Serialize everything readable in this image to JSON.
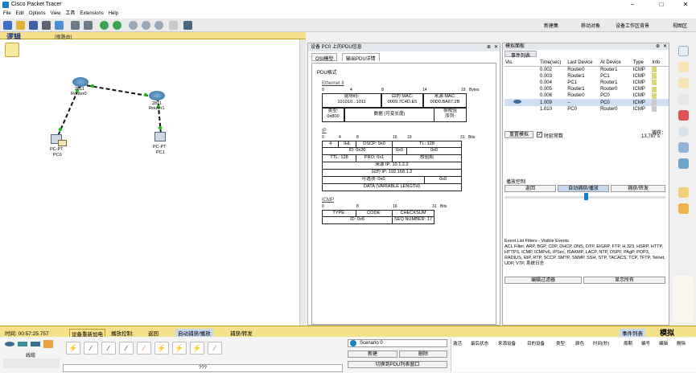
{
  "app": {
    "title": "Cisco Packet Tracer",
    "minimize": "–",
    "maximize": "□",
    "close": "✕"
  },
  "menu": [
    "File",
    "Edit",
    "Options",
    "View",
    "工具",
    "Extensions",
    "Help"
  ],
  "toolbar_right": [
    "新建集",
    "移动对象",
    "设备工作区背景",
    "视图区"
  ],
  "workspace": {
    "mode_label": "逻辑",
    "root_label": "[根路由]",
    "devices": [
      {
        "name": "Router0",
        "model": "2811",
        "type": "router"
      },
      {
        "name": "Router1",
        "model": "2811",
        "type": "router"
      },
      {
        "name": "PC0",
        "model": "PC-PT",
        "type": "pc"
      },
      {
        "name": "PC1",
        "model": "PC-PT",
        "type": "pc"
      }
    ]
  },
  "pdu": {
    "window_title": "设备 PC0 上的PDU信息",
    "tabs": [
      "OSI模型",
      "输出PDU详情"
    ],
    "heading": "PDU格式",
    "ethernet": {
      "title": "Ethernet II",
      "ruler": [
        "0",
        "4",
        "8",
        "14",
        "19",
        "Bytes"
      ],
      "preamble_label": "前导码:",
      "preamble": "101010...1011",
      "dst_label": "目的 MAC:",
      "dst": "0009.7C4D.E5",
      "src_label": "来源 MAC:",
      "src": "00D0.BA67.2B",
      "type_label": "类型:",
      "type": "0x800",
      "data": "数据 (可变长度)",
      "fcs_label": "帧校验",
      "fcs": "序列:"
    },
    "ip": {
      "title": "IP",
      "ruler": [
        "0",
        "4",
        "8",
        "16",
        "19",
        "31",
        "Bits"
      ],
      "version": "4",
      "ihl": "IHL",
      "dscp": "DSCP: 0x0",
      "tl": "TL: 128",
      "id": "ID: 0x20",
      "flags": "0x0",
      "frag": "0x0",
      "ttl": "TTL: 128",
      "proto": "PRO: 0x1",
      "checksum": "校验和",
      "src": "来源 IP: 10.1.2.2",
      "dst": "目的 IP: 192.168.1.2",
      "options": "可选项: 0x0",
      "padding": "0x0",
      "data": "DATA (VARIABLE LENGTH)"
    },
    "icmp": {
      "title": "ICMP",
      "ruler": [
        "0",
        "8",
        "16",
        "31",
        "Bits"
      ],
      "type": "TYPE:",
      "code": "CODE:",
      "checksum": "CHECKSUM",
      "id": "ID: 0x6",
      "seq": "SEQ NUMBER: 17"
    }
  },
  "sim": {
    "window_title": "模拟面板",
    "list_title": "事件列表",
    "columns": [
      "Vis.",
      "Time(sec)",
      "Last Device",
      "At Device",
      "Type",
      "Info"
    ],
    "events": [
      {
        "time": "0.002",
        "last": "Router0",
        "at": "Router1",
        "type": "ICMP",
        "color": "#d8d87a"
      },
      {
        "time": "0.003",
        "last": "Router1",
        "at": "PC1",
        "type": "ICMP",
        "color": "#d8d87a"
      },
      {
        "time": "0.004",
        "last": "PC1",
        "at": "Router1",
        "type": "ICMP",
        "color": "#d8d87a"
      },
      {
        "time": "0.005",
        "last": "Router1",
        "at": "Router0",
        "type": "ICMP",
        "color": "#d8d87a"
      },
      {
        "time": "0.006",
        "last": "Router0",
        "at": "PC0",
        "type": "ICMP",
        "color": "#d8d87a"
      },
      {
        "time": "1.009",
        "last": "--",
        "at": "PC0",
        "type": "ICMP",
        "color": "#c8c8c8"
      },
      {
        "time": "1.010",
        "last": "PC0",
        "at": "Router0",
        "type": "ICMP",
        "color": "#c8c8c8"
      }
    ],
    "reset_button": "重置模拟",
    "constant_delay": "时延常数",
    "capture_label": "捕获：",
    "capture_value": "13.787 s",
    "play_controls": "播放控制",
    "back_button": "返回",
    "autoplay_button": "自动捕获/播放",
    "forward_button": "捕获/转发",
    "filter_text": "Event List Filters - Visible Events\nACL Filter, ARP, BGP, CDP, DHCP, DNS, DTP, EIGRP, FTP, H.323, HSRP, HTTP, HTTPS, ICMP, ICMPv6, IPSec, ISAKMP, LACP, NTP, OSPF, PAgP, POP3, RADIUS, RIP, RTP, SCCP, SMTP, SNMP, SSH, STP, TACACS, TCP, TFTP, Telnet, UDP, VTP, 系统日志",
    "edit_filters": "编辑过滤器",
    "show_all": "显示所有"
  },
  "status": {
    "time": "时间: 00:57:25.757",
    "power": "设备重新加电",
    "play_label": "播放控制:",
    "back": "返回",
    "auto": "自动捕获/播放",
    "forward": "捕获/转发",
    "event_list": "事件列表",
    "sim_mode": "模拟"
  },
  "bottom": {
    "category": "线缆",
    "cable_caption": "???",
    "scenario": "Scenario 0",
    "new": "新建",
    "delete": "删除",
    "toggle_pdu": "切换到PDU列表窗口",
    "columns": [
      "激活",
      "最后状态",
      "来源设备",
      "目的设备",
      "类型",
      "颜色",
      "时间(秒)",
      "周期",
      "编号",
      "编辑",
      "删除"
    ]
  }
}
